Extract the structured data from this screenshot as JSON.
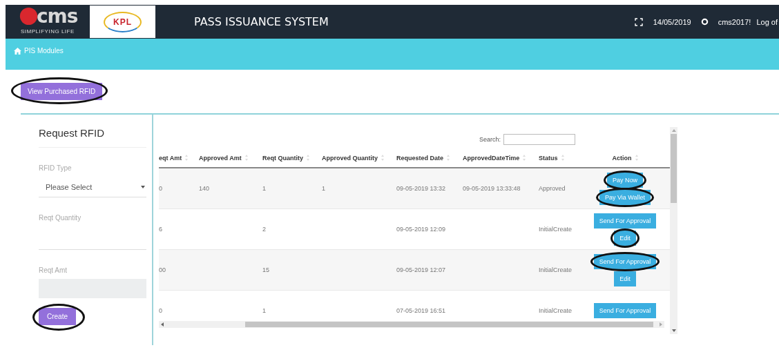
{
  "header": {
    "logo_main": "cms",
    "logo_tagline": "SIMPLIFYING LIFE",
    "partner_logo": "KPL",
    "title": "PASS ISSUANCE SYSTEM",
    "date": "14/05/2019",
    "user": "cms2017!",
    "logout": "Log of"
  },
  "breadcrumb": {
    "label": "PIS Modules"
  },
  "view_button": {
    "label": "View Purchased RFID",
    "circled": true
  },
  "form": {
    "title": "Request RFID",
    "fields": [
      {
        "kind": "select",
        "label": "RFID Type",
        "value": "Please Select"
      },
      {
        "kind": "input",
        "label": "Reqt Quantity"
      },
      {
        "kind": "readonly",
        "label": "Reqt Amt"
      }
    ],
    "create_button": {
      "label": "Create",
      "circled": true
    }
  },
  "table": {
    "search_label": "Search:",
    "columns": [
      "eqt Amt",
      "Approved Amt",
      "Reqt Quantity",
      "Approved Quantity",
      "Requested Date",
      "ApprovedDateTime",
      "Status",
      "Action"
    ],
    "rows": [
      {
        "cells": [
          "0",
          "140",
          "1",
          "1",
          "09-05-2019 13:32",
          "09-05-2019 13:33:48",
          "Approved"
        ],
        "actions": [
          {
            "label": "Pay Now",
            "circled": true
          },
          {
            "label": "Pay Via Wallet",
            "circled": true
          }
        ]
      },
      {
        "cells": [
          "6",
          "",
          "2",
          "",
          "09-05-2019 12:09",
          "",
          "InitialCreate"
        ],
        "actions": [
          {
            "label": "Send For Approval",
            "circled": false
          },
          {
            "label": "Edit",
            "circled": true
          }
        ]
      },
      {
        "cells": [
          "00",
          "",
          "15",
          "",
          "09-05-2019 12:07",
          "",
          "InitialCreate"
        ],
        "actions": [
          {
            "label": "Send For Approval",
            "circled": true
          },
          {
            "label": "Edit",
            "circled": false
          }
        ]
      },
      {
        "cells": [
          "0",
          "",
          "1",
          "",
          "07-05-2019 16:51",
          "",
          "InitialCreate"
        ],
        "actions": [
          {
            "label": "Send For Approval",
            "circled": false
          }
        ]
      }
    ]
  }
}
